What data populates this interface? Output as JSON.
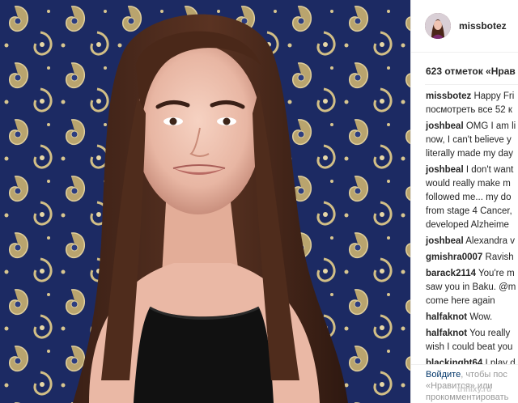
{
  "post": {
    "username": "missbotez",
    "likes_text": "623 отметок «Нрав",
    "caption": {
      "user": "missbotez",
      "text": "Happy Fri"
    },
    "timestamp": "посмотреть все 52 к"
  },
  "comments": [
    {
      "user": "joshbeal",
      "lines": [
        "OMG I am li",
        "now, I can't believe y",
        "literally made my day"
      ]
    },
    {
      "user": "joshbeal",
      "lines": [
        "I don't want",
        "would really make m",
        "followed me... my do",
        "from stage 4 Cancer,",
        "developed Alzheime"
      ]
    },
    {
      "user": "joshbeal",
      "lines": [
        "Alexandra v"
      ]
    },
    {
      "user": "gmishra0007",
      "lines": [
        "Ravish"
      ]
    },
    {
      "user": "barack2114",
      "lines": [
        "You're m",
        "saw you in Baku. @m",
        "come here again"
      ]
    },
    {
      "user": "halfaknot",
      "lines": [
        "Wow."
      ]
    },
    {
      "user": "halfaknot",
      "lines": [
        "You really",
        "wish I could beat you"
      ]
    },
    {
      "user": "blackinght64",
      "lines": [
        "I play d"
      ]
    }
  ],
  "footer": {
    "login_link": "Войдите",
    "login_rest": ", чтобы пос",
    "line2": "«Нравится» или",
    "line3": "прокомментировать"
  },
  "watermark": "trinixy.ru",
  "colors": {
    "tapestry_blue": "#1c2a63",
    "tapestry_gold": "#c9b27a",
    "link": "#003569",
    "muted": "#999999"
  },
  "icons": {
    "avatar": "profile-avatar"
  }
}
